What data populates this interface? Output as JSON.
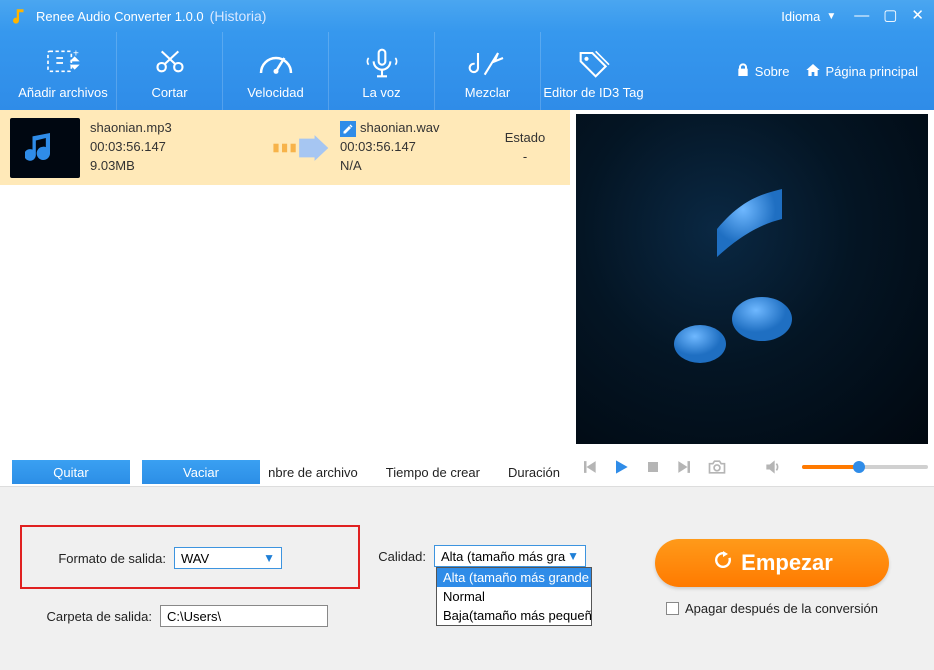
{
  "title": {
    "main": "Renee Audio Converter 1.0.0",
    "sub": "(Historia)"
  },
  "language_label": "Idioma",
  "toolbar": [
    {
      "key": "add",
      "label": "Añadir archivos"
    },
    {
      "key": "cut",
      "label": "Cortar"
    },
    {
      "key": "speed",
      "label": "Velocidad"
    },
    {
      "key": "voice",
      "label": "La voz"
    },
    {
      "key": "mix",
      "label": "Mezclar"
    },
    {
      "key": "id3",
      "label": "Editor de ID3 Tag"
    }
  ],
  "rlinks": {
    "about": "Sobre",
    "home": "Página principal"
  },
  "row": {
    "src": {
      "name": "shaonian.mp3",
      "duration": "00:03:56.147",
      "size": "9.03MB"
    },
    "dst": {
      "name": "shaonian.wav",
      "duration": "00:03:56.147",
      "size": "N/A"
    },
    "status_header": "Estado",
    "status_value": "-"
  },
  "list_buttons": {
    "remove": "Quitar",
    "clear": "Vaciar"
  },
  "list_columns": {
    "filename": "nbre de archivo",
    "created": "Tiempo de crear",
    "length": "Duración"
  },
  "settings": {
    "out_format_label": "Formato de salida:",
    "out_format_value": "WAV",
    "out_folder_label": "Carpeta de salida:",
    "out_folder_value": "C:\\Users\\",
    "quality_label": "Calidad:",
    "quality_selected_short": "Alta (tamaño más gra",
    "quality_options": [
      "Alta (tamaño más grande",
      "Normal",
      "Baja(tamaño más pequeñ"
    ]
  },
  "start_label": "Empezar",
  "shutdown_label": "Apagar después de la conversión"
}
